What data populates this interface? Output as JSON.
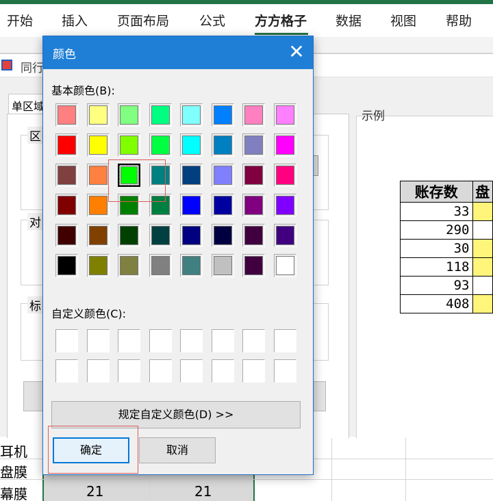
{
  "ribbon": {
    "tabs": [
      "开始",
      "插入",
      "页面布局",
      "公式",
      "方方格子",
      "数据",
      "视图",
      "帮助"
    ],
    "active_tab": "方方格子"
  },
  "background_dialog": {
    "title": "同行",
    "tab_label": "单区域",
    "group_labels": [
      "区",
      "对",
      "标"
    ],
    "example_label": "示例",
    "example_table": {
      "headers": [
        "账存数",
        "盘"
      ],
      "values": [
        "33",
        "290",
        "30",
        "118",
        "93",
        "408"
      ]
    }
  },
  "sheet": {
    "row_labels": [
      "耳机",
      "盘膜",
      "幕膜"
    ],
    "row3_values": [
      "21",
      "21"
    ]
  },
  "color_dialog": {
    "title": "颜色",
    "basic_label": "基本颜色(B):",
    "custom_label": "自定义颜色(C):",
    "define_button": "规定自定义颜色(D) >>",
    "ok_button": "确定",
    "cancel_button": "取消",
    "close_icon": "close-icon",
    "basic_colors": [
      [
        "#ff8080",
        "#ffff80",
        "#80ff80",
        "#00ff80",
        "#80ffff",
        "#0080ff",
        "#ff80c0",
        "#ff80ff"
      ],
      [
        "#ff0000",
        "#ffff00",
        "#80ff00",
        "#00ff40",
        "#00ffff",
        "#0080c0",
        "#8080c0",
        "#ff00ff"
      ],
      [
        "#804040",
        "#ff8040",
        "#00ff00",
        "#008080",
        "#004080",
        "#8080ff",
        "#800040",
        "#ff0080"
      ],
      [
        "#800000",
        "#ff8000",
        "#008000",
        "#008040",
        "#0000ff",
        "#0000a0",
        "#800080",
        "#8000ff"
      ],
      [
        "#400000",
        "#804000",
        "#004000",
        "#004040",
        "#000080",
        "#000040",
        "#400040",
        "#400080"
      ],
      [
        "#000000",
        "#808000",
        "#808040",
        "#808080",
        "#408080",
        "#c0c0c0",
        "#400040",
        "#ffffff"
      ]
    ],
    "selected": {
      "row": 2,
      "col": 2
    }
  }
}
